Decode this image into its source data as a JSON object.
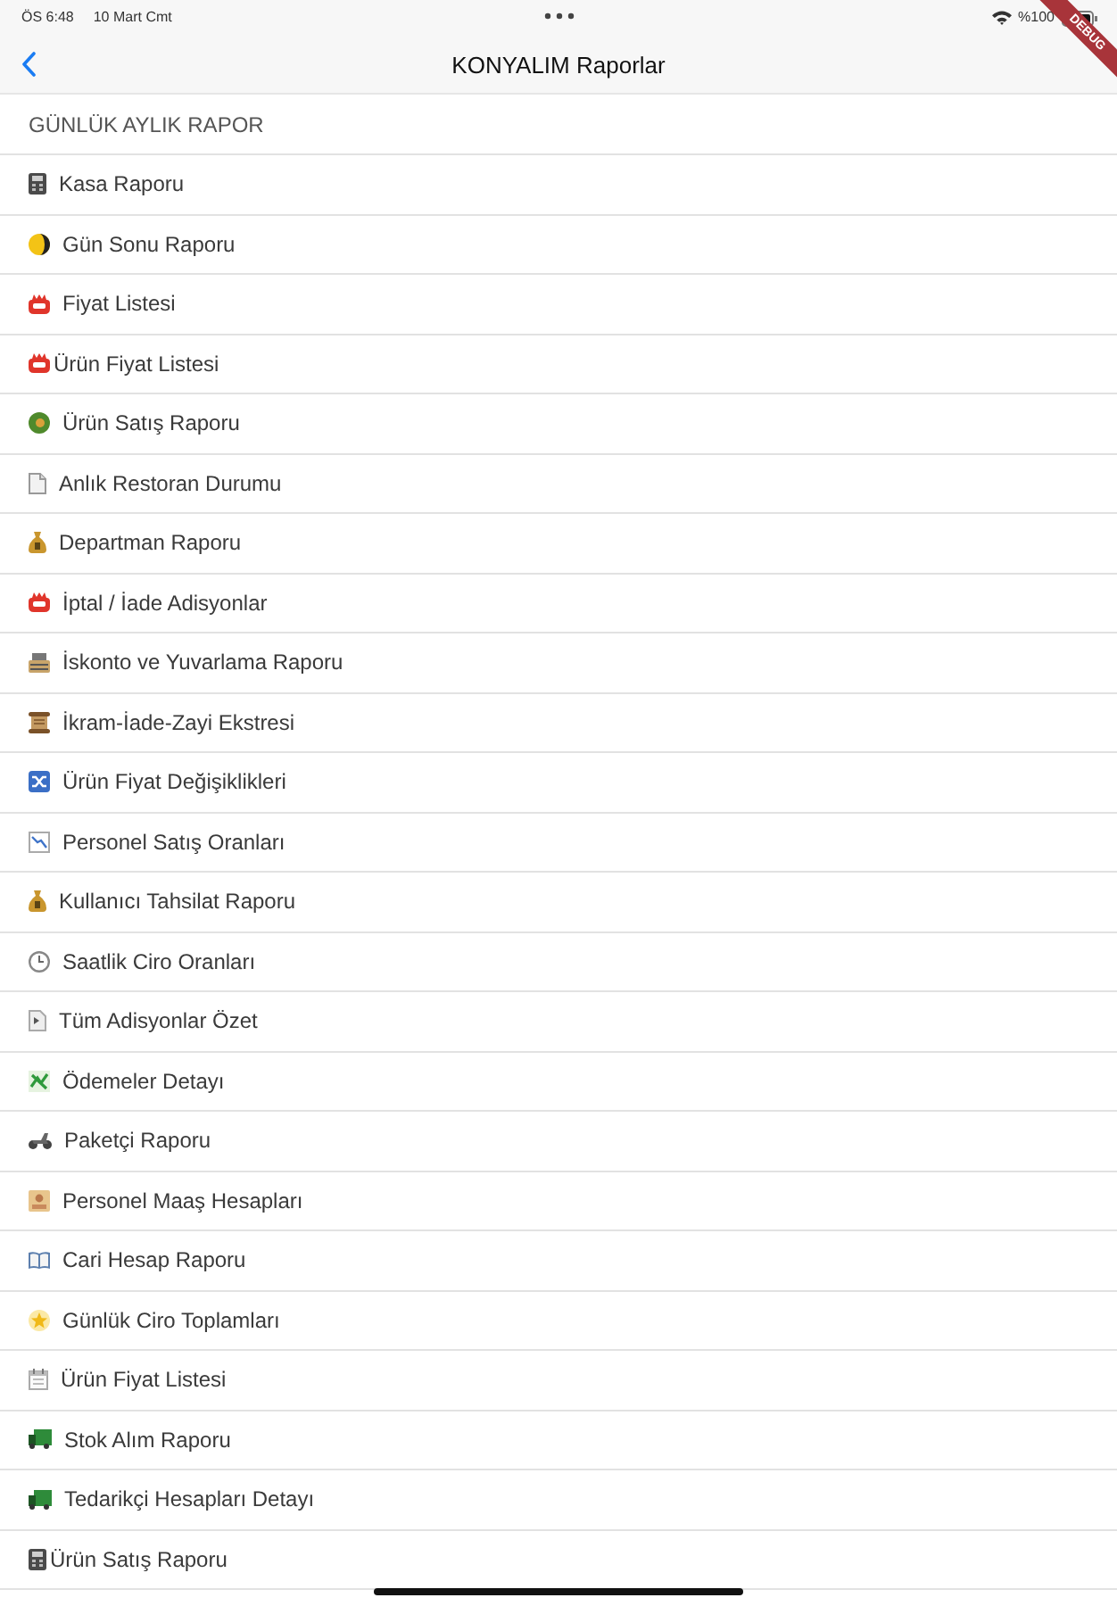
{
  "status_bar": {
    "time": "ÖS 6:48",
    "date": "10 Mart Cmt",
    "battery": "%100"
  },
  "debug_banner": {
    "label": "DEBUG"
  },
  "nav_bar": {
    "title": "KONYALIM Raporlar"
  },
  "section": {
    "title": "GÜNLÜK AYLIK RAPOR"
  },
  "reports": [
    {
      "label": "Kasa Raporu"
    },
    {
      "label": "Gün Sonu Raporu"
    },
    {
      "label": "Fiyat Listesi"
    },
    {
      "label": "Ürün Fiyat Listesi"
    },
    {
      "label": "Ürün Satış Raporu"
    },
    {
      "label": "Anlık Restoran Durumu"
    },
    {
      "label": "Departman Raporu"
    },
    {
      "label": "İptal / İade Adisyonlar"
    },
    {
      "label": "İskonto ve Yuvarlama Raporu"
    },
    {
      "label": "İkram-İade-Zayi Ekstresi"
    },
    {
      "label": "Ürün Fiyat Değişiklikleri"
    },
    {
      "label": "Personel Satış Oranları"
    },
    {
      "label": "Kullanıcı Tahsilat Raporu"
    },
    {
      "label": "Saatlik Ciro Oranları"
    },
    {
      "label": "Tüm Adisyonlar Özet"
    },
    {
      "label": "Ödemeler Detayı"
    },
    {
      "label": "Paketçi Raporu"
    },
    {
      "label": "Personel Maaş Hesapları"
    },
    {
      "label": "Cari Hesap Raporu"
    },
    {
      "label": "Günlük Ciro Toplamları"
    },
    {
      "label": "Ürün Fiyat Listesi"
    },
    {
      "label": "Stok Alım Raporu"
    },
    {
      "label": "Tedarikçi Hesapları Detayı"
    },
    {
      "label": "Ürün Satış Raporu"
    }
  ]
}
